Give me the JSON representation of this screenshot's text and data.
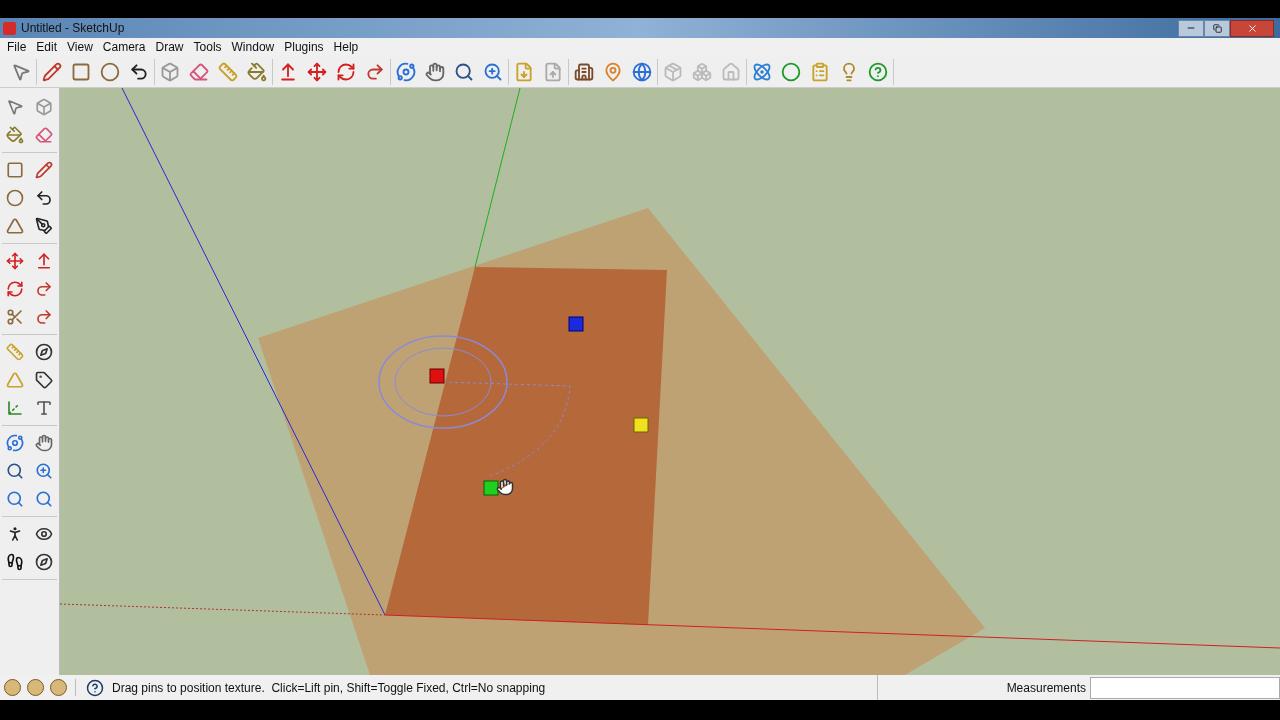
{
  "window": {
    "title": "Untitled - SketchUp"
  },
  "menu": [
    "File",
    "Edit",
    "View",
    "Camera",
    "Draw",
    "Tools",
    "Window",
    "Plugins",
    "Help"
  ],
  "status_bar": {
    "text": "Drag pins to position texture.  Click=Lift pin, Shift=Toggle Fixed, Ctrl=No snapping",
    "measurements_label": "Measurements"
  }
}
